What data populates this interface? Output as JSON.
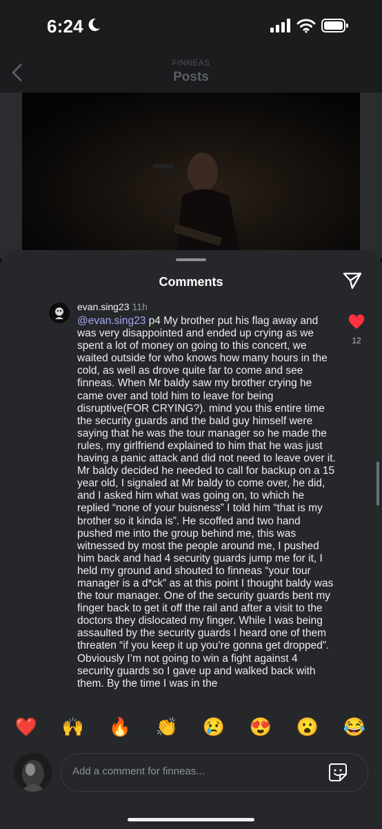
{
  "status_bar": {
    "time": "6:24"
  },
  "nav": {
    "subtitle": "FINNEAS",
    "title": "Posts"
  },
  "comments_sheet": {
    "title": "Comments",
    "comment": {
      "username": "evan.sing23",
      "time_ago": "11h",
      "mention": "@evan.sing23",
      "text": " p4 My brother put his flag away and was very disappointed and ended up crying as we spent a lot of money on going to this concert, we waited outside for who knows how many hours in the cold, as well as drove quite far to come and see finneas. When Mr baldy saw my brother crying he came over and told him to leave for being disruptive(FOR CRYING?). mind you this entire time the security guards and the bald guy himself were saying that he was the tour manager so he made the rules, my girlfriend explained to him that he was just having a panic attack and did not need to leave over it. Mr baldy decided he needed to call for backup on a 15 year old, I signaled at Mr baldy to come over, he did, and I asked him what was going on, to which he replied “none of your buisness” I told him “that is my brother so it kinda is”. He scoffed and two hand pushed me into the group behind me, this was witnessed by most the people around me, I pushed him back and had 4 security guards jump me for it, I held my ground and shouted to finneas “your tour manager is a d*ck” as at this point I thought baldy was the tour manager. One of the security guards bent my finger back to get it off the rail and after a visit to the doctors they dislocated my finger. While I was being assaulted by the security guards I heard one of them threaten “if you keep it up you’re gonna get dropped”. Obviously I’m not going to win a fight against 4 security guards so I gave up and walked back with them. By the time I was in the",
      "like_count": "12",
      "liked": true
    },
    "quick_reactions": [
      "❤️",
      "🙌",
      "🔥",
      "👏",
      "😢",
      "😍",
      "😮",
      "😂"
    ],
    "input": {
      "placeholder": "Add a comment for finneas..."
    }
  },
  "colors": {
    "sheet_bg": "#25272b",
    "mention": "#a5a8f5",
    "like_heart": "#ff3040",
    "status_bg": "#1b1c1e"
  },
  "icons": {
    "back": "chevron-left-icon",
    "send": "paper-plane-icon",
    "like": "heart-icon",
    "sticker": "sticker-icon",
    "moon": "moon-icon"
  }
}
